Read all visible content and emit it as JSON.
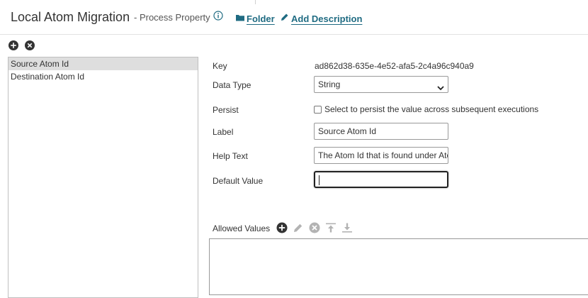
{
  "header": {
    "title": "Local Atom Migration",
    "subtitle": "- Process Property",
    "folder_label": "Folder",
    "add_description_label": "Add Description"
  },
  "properties_list": {
    "items": [
      {
        "label": "Source Atom Id",
        "selected": true
      },
      {
        "label": "Destination Atom Id",
        "selected": false
      }
    ]
  },
  "form": {
    "key_label": "Key",
    "key_value": "ad862d38-635e-4e52-afa5-2c4a96c940a9",
    "data_type_label": "Data Type",
    "data_type_value": "String",
    "persist_label": "Persist",
    "persist_text": "Select to persist the value across subsequent executions",
    "persist_checked": false,
    "label_label": "Label",
    "label_value": "Source Atom Id",
    "help_text_label": "Help Text",
    "help_text_value": "The Atom Id that is found under Atom Management",
    "default_value_label": "Default Value",
    "default_value_value": "",
    "allowed_values_label": "Allowed Values"
  },
  "colors": {
    "link": "#1f6b82",
    "icon_dark": "#333333",
    "icon_disabled": "#b3b3b3",
    "selected_row": "#dedede"
  },
  "icons": {
    "info": "info-circle-icon",
    "folder": "folder-icon",
    "pencil": "pencil-icon",
    "add": "plus-circle-icon",
    "remove": "x-circle-icon",
    "move_top": "move-to-top-icon",
    "move_bottom": "move-to-bottom-icon"
  }
}
